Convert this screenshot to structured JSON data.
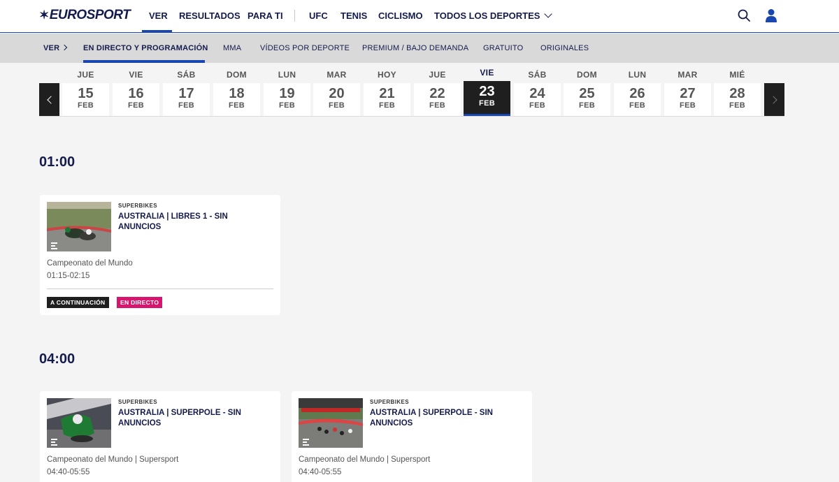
{
  "brand": {
    "logo_text": "EUROSPORT",
    "accent": "#1a46b0",
    "live_color": "#d6166e"
  },
  "topnav": {
    "items": [
      "VER",
      "RESULTADOS",
      "PARA TI",
      "UFC",
      "TENIS",
      "CICLISMO",
      "TODOS LOS DEPORTES"
    ],
    "active": "VER",
    "icons": [
      "search-icon",
      "user-icon",
      "chevron-down-icon"
    ]
  },
  "subnav": {
    "root": "VER",
    "items": [
      "EN DIRECTO Y PROGRAMACIÓN",
      "MMA",
      "VÍDEOS POR DEPORTE",
      "PREMIUM / BAJO DEMANDA",
      "GRATUITO",
      "ORIGINALES"
    ],
    "active": "EN DIRECTO Y PROGRAMACIÓN"
  },
  "dates": [
    {
      "day": "JUE",
      "num": "15",
      "mon": "FEB"
    },
    {
      "day": "VIE",
      "num": "16",
      "mon": "FEB"
    },
    {
      "day": "SÁB",
      "num": "17",
      "mon": "FEB"
    },
    {
      "day": "DOM",
      "num": "18",
      "mon": "FEB"
    },
    {
      "day": "LUN",
      "num": "19",
      "mon": "FEB"
    },
    {
      "day": "MAR",
      "num": "20",
      "mon": "FEB"
    },
    {
      "day": "HOY",
      "num": "21",
      "mon": "FEB"
    },
    {
      "day": "JUE",
      "num": "22",
      "mon": "FEB"
    },
    {
      "day": "VIE",
      "num": "23",
      "mon": "FEB"
    },
    {
      "day": "SÁB",
      "num": "24",
      "mon": "FEB"
    },
    {
      "day": "DOM",
      "num": "25",
      "mon": "FEB"
    },
    {
      "day": "LUN",
      "num": "26",
      "mon": "FEB"
    },
    {
      "day": "MAR",
      "num": "27",
      "mon": "FEB"
    },
    {
      "day": "MIÉ",
      "num": "28",
      "mon": "FEB"
    }
  ],
  "active_date": "23",
  "schedule": [
    {
      "time": "01:00",
      "events": [
        {
          "sport": "SUPERBIKES",
          "title": "AUSTRALIA | LIBRES 1 - SIN ANUNCIOS",
          "competition": "Campeonato del Mundo",
          "hours": "01:15-02:15",
          "badges": [
            "A CONTINUACIÓN",
            "EN DIRECTO"
          ]
        }
      ]
    },
    {
      "time": "04:00",
      "events": [
        {
          "sport": "SUPERBIKES",
          "title": "AUSTRALIA | SUPERPOLE - SIN ANUNCIOS",
          "competition": "Campeonato del Mundo | Supersport",
          "hours": "04:40-05:55"
        },
        {
          "sport": "SUPERBIKES",
          "title": "AUSTRALIA | SUPERPOLE - SIN ANUNCIOS",
          "competition": "Campeonato del Mundo | Supersport",
          "hours": "04:40-05:55"
        }
      ]
    }
  ]
}
